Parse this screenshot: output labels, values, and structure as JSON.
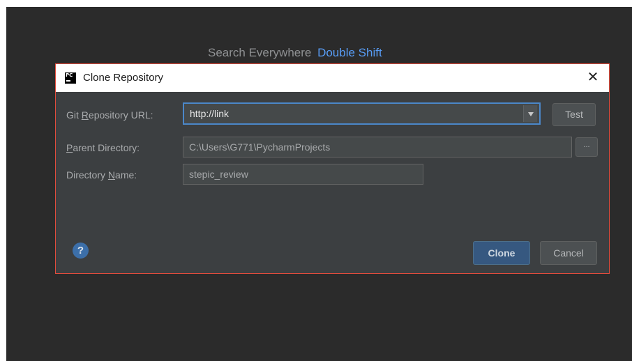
{
  "background_hint": {
    "text": "Search Everywhere",
    "shortcut": "Double Shift"
  },
  "dialog": {
    "title": "Clone Repository",
    "app_icon": "pycharm-icon",
    "close_glyph": "✕",
    "fields": {
      "url": {
        "label_prefix": "Git ",
        "label_mnemonic": "R",
        "label_rest": "epository URL:",
        "value": "http://link"
      },
      "parent": {
        "label_prefix": "",
        "label_mnemonic": "P",
        "label_rest": "arent Directory:",
        "value": "C:\\Users\\G771\\PycharmProjects"
      },
      "dirname": {
        "label_prefix": "Directory ",
        "label_mnemonic": "N",
        "label_rest": "ame:",
        "value": "stepic_review"
      }
    },
    "buttons": {
      "test": "Test",
      "browse": "...",
      "clone": "Clone",
      "cancel": "Cancel",
      "help": "?"
    }
  },
  "colors": {
    "ide_background": "#2b2b2b",
    "dialog_background": "#3c3f41",
    "dialog_border": "#e24c3c",
    "focus_border": "#4b87c9",
    "shortcut_accent": "#589df6",
    "default_button": "#365880"
  }
}
